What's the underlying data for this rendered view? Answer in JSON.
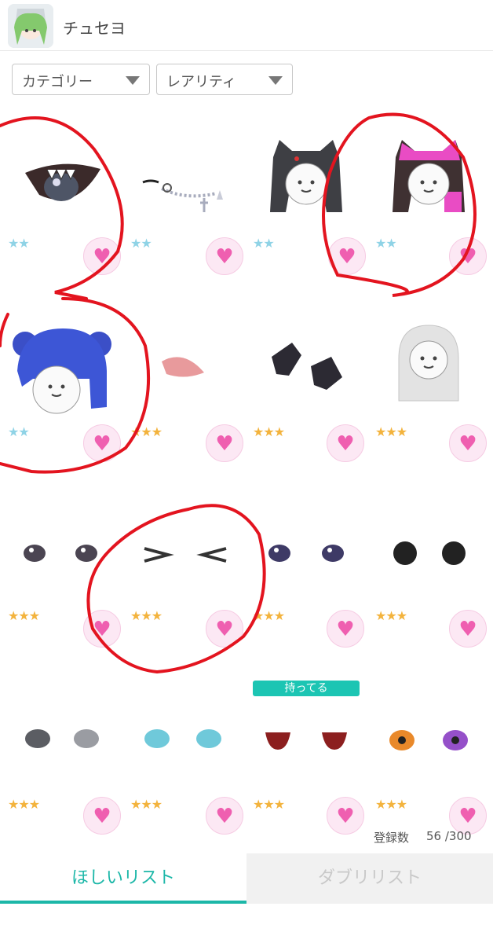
{
  "header": {
    "username": "チュセヨ"
  },
  "filters": {
    "category": "カテゴリー",
    "rarity": "レアリティ"
  },
  "items": [
    {
      "stars": "★★",
      "rarity": 2,
      "desc": "eye-with-teeth"
    },
    {
      "stars": "★★",
      "rarity": 2,
      "desc": "mustache-chain"
    },
    {
      "stars": "★★",
      "rarity": 2,
      "desc": "black-cat-hood"
    },
    {
      "stars": "★★",
      "rarity": 2,
      "desc": "pink-cat-hood"
    },
    {
      "stars": "★★",
      "rarity": 2,
      "desc": "kuma-beanie"
    },
    {
      "stars": "★★★",
      "rarity": 3,
      "desc": "pink-nose"
    },
    {
      "stars": "★★★",
      "rarity": 3,
      "desc": "black-gloves"
    },
    {
      "stars": "★★★",
      "rarity": 3,
      "desc": "white-hair"
    },
    {
      "stars": "★★★",
      "rarity": 3,
      "desc": "gray-eyes"
    },
    {
      "stars": "★★★",
      "rarity": 3,
      "desc": "squint-eyes"
    },
    {
      "stars": "★★★",
      "rarity": 3,
      "desc": "navy-eyes"
    },
    {
      "stars": "★★★",
      "rarity": 3,
      "desc": "black-round-eyes"
    },
    {
      "stars": "★★★",
      "rarity": 3,
      "desc": "gray-lined-eyes"
    },
    {
      "stars": "★★★",
      "rarity": 3,
      "desc": "cyan-eyes"
    },
    {
      "stars": "★★★",
      "rarity": 3,
      "desc": "red-eyes"
    },
    {
      "stars": "★★★",
      "rarity": 3,
      "desc": "orange-purple-eyes"
    }
  ],
  "owned_badge": "持ってる",
  "registration": {
    "label": "登録数",
    "value": "56 /300"
  },
  "tabs": {
    "wishlist": "ほしいリスト",
    "duplicates": "ダブリリスト"
  },
  "colors": {
    "accent": "#1cb7a8",
    "heart": "#ef5fb0",
    "annotation": "#e3141f"
  }
}
